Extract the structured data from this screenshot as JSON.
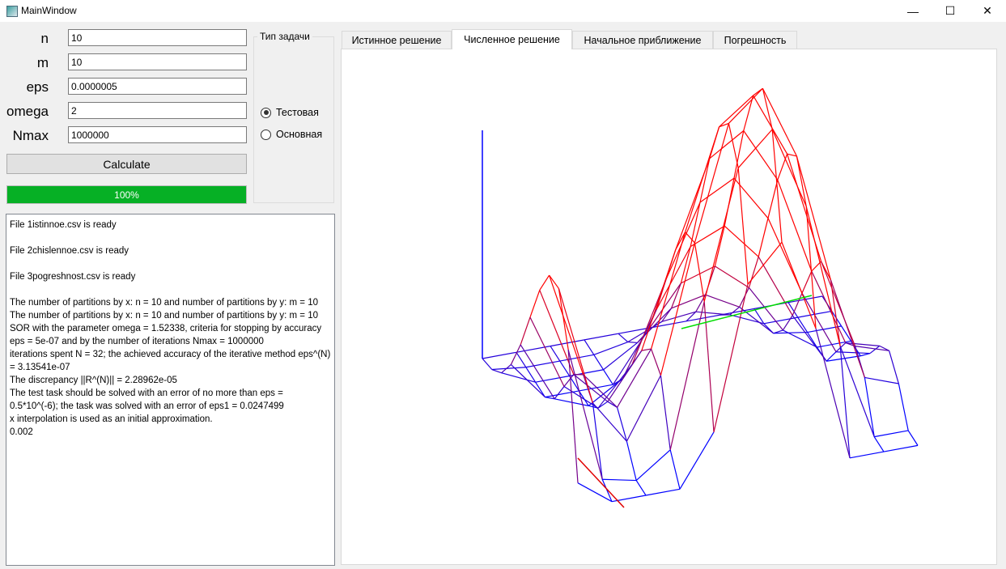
{
  "window": {
    "title": "MainWindow",
    "controls": {
      "minimize": "—",
      "maximize": "☐",
      "close": "✕"
    }
  },
  "form": {
    "fields": [
      {
        "label": "n",
        "value": "10"
      },
      {
        "label": "m",
        "value": "10"
      },
      {
        "label": "eps",
        "value": "0.0000005"
      },
      {
        "label": "omega",
        "value": "2"
      },
      {
        "label": "Nmax",
        "value": "1000000"
      }
    ],
    "calculate_label": "Calculate",
    "progress": {
      "value": 1.0,
      "text": "100%",
      "color": "#06b025"
    }
  },
  "task_type": {
    "title": "Тип задачи",
    "options": [
      {
        "label": "Тестовая",
        "checked": true
      },
      {
        "label": "Основная",
        "checked": false
      }
    ]
  },
  "log": {
    "text": "File 1istinnoe.csv is ready\n\nFile 2chislennoe.csv is ready\n\nFile 3pogreshnost.csv is ready\n\nThe number of partitions by x: n = 10 and number of partitions by y: m = 10\nThe number of partitions by x: n = 10 and number of partitions by y: m = 10\nSOR with the parameter omega = 1.52338, criteria for stopping by accuracy eps = 5e-07 and by the number of iterations Nmax = 1000000\niterations spent N = 32; the achieved accuracy of the iterative method eps^(N) = 3.13541e-07\nThe discrepancy ||R^(N)|| = 2.28962e-05\nThe test task should be solved with an error of no more than eps = 0.5*10^(-6); the task was solved with an error of eps1 = 0.0247499\nx interpolation is used as an initial approximation.\n0.002"
  },
  "tabs": [
    {
      "label": "Истинное решение",
      "active": false
    },
    {
      "label": "Численное решение",
      "active": true
    },
    {
      "label": "Начальное приближение",
      "active": false
    },
    {
      "label": "Погрешность",
      "active": false
    }
  ],
  "plot": {
    "colors": {
      "axis_x": "#e00000",
      "axis_y": "#00dd00",
      "axis_z": "#0000ff",
      "low": "#0000ff",
      "high": "#ff0000"
    }
  }
}
